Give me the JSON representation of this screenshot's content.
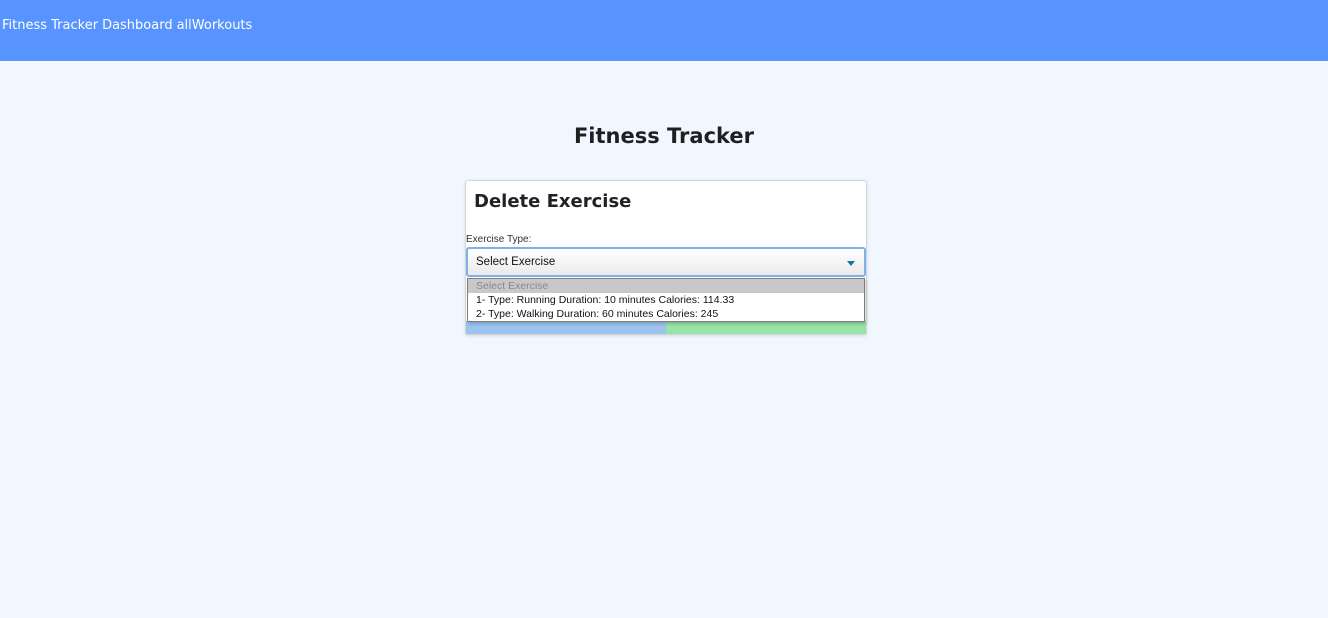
{
  "navbar": {
    "brand": "Fitness Tracker",
    "links": [
      "Dashboard",
      "allWorkouts"
    ]
  },
  "page_title": "Fitness Tracker",
  "card": {
    "title": "Delete Exercise",
    "field_label": "Exercise Type:",
    "select": {
      "value": "Select Exercise",
      "options": [
        "Select Exercise",
        "1- Type: Running Duration: 10 minutes Calories: 114.33",
        "2- Type: Walking Duration: 60 minutes Calories: 245"
      ],
      "dropdown_open": true
    }
  },
  "colors": {
    "navbar": "#5794ff",
    "background": "#f0f7ff",
    "left_button": "#9cc4ee",
    "right_button": "#98e3a6"
  }
}
